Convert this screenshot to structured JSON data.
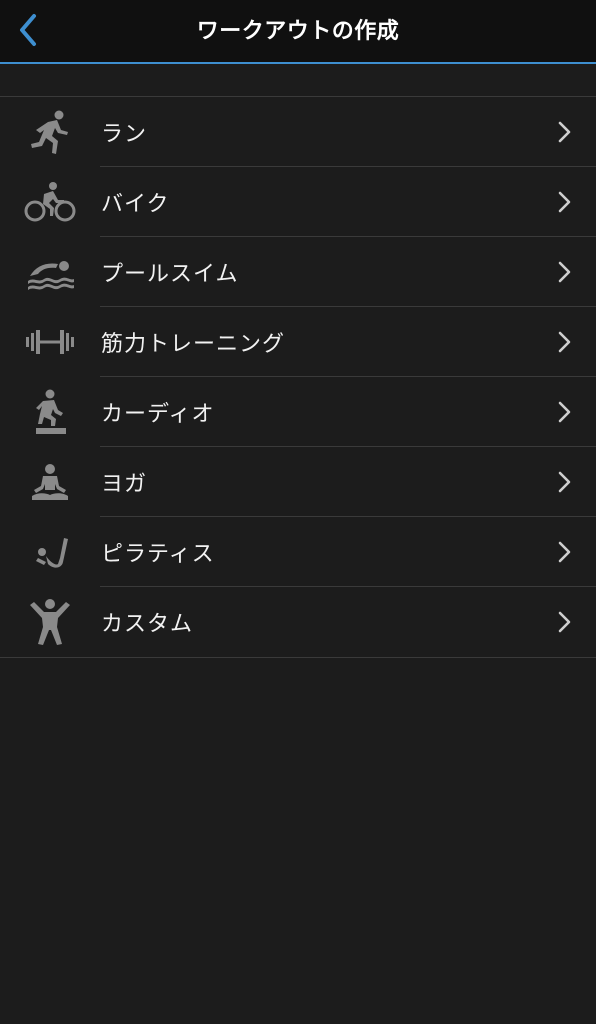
{
  "header": {
    "title": "ワークアウトの作成",
    "back_icon": "chevron-left-icon",
    "accent_color": "#3e8fd0"
  },
  "workout_types": [
    {
      "label": "ラン",
      "icon": "running-icon"
    },
    {
      "label": "バイク",
      "icon": "bike-icon"
    },
    {
      "label": "プールスイム",
      "icon": "swim-icon"
    },
    {
      "label": "筋力トレーニング",
      "icon": "dumbbell-icon"
    },
    {
      "label": "カーディオ",
      "icon": "cardio-step-icon"
    },
    {
      "label": "ヨガ",
      "icon": "yoga-icon"
    },
    {
      "label": "ピラティス",
      "icon": "pilates-icon"
    },
    {
      "label": "カスタム",
      "icon": "custom-person-icon"
    }
  ]
}
